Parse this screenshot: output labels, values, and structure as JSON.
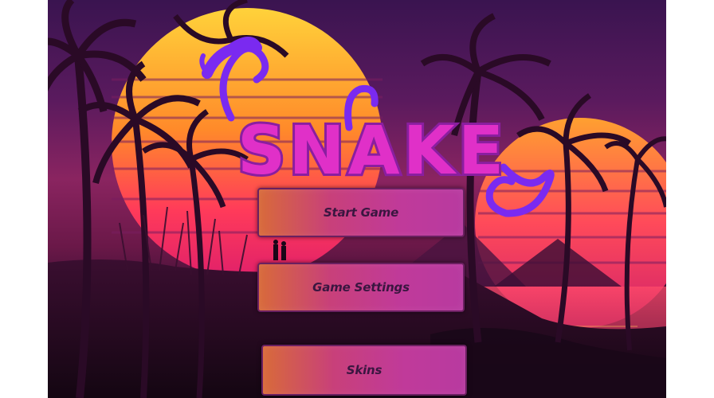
{
  "game": {
    "title": "SNAKE",
    "menu": {
      "start_label": "Start Game",
      "settings_label": "Game Settings",
      "skins_label": "Skins"
    }
  },
  "colors": {
    "sun_top": "#ffd23a",
    "sun_bottom": "#ff2a6a",
    "logo_fill": "#e030c8",
    "logo_outline": "#8a1ea0",
    "snake_purple": "#7a2af0",
    "button_left": "#d86a3a",
    "button_right": "#b83aa0"
  }
}
